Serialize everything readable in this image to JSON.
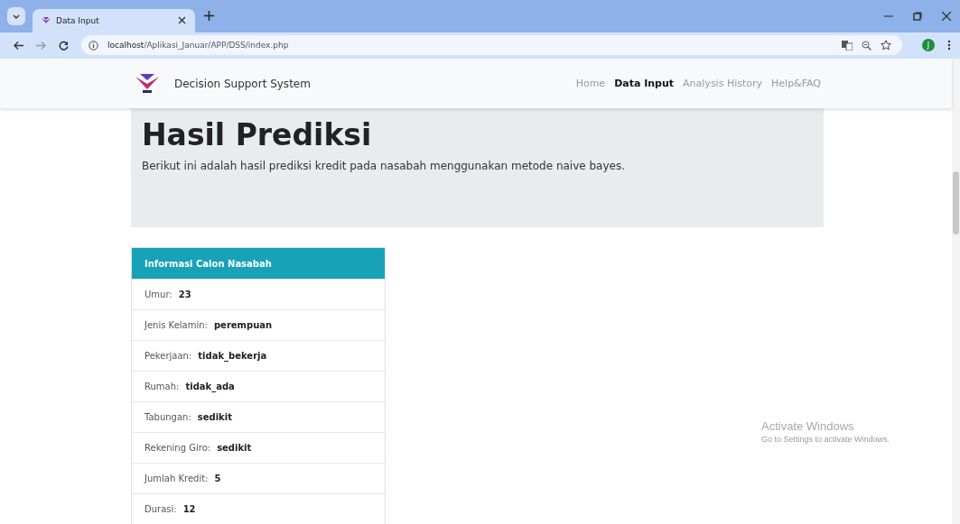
{
  "browser": {
    "tab_title": "Data Input",
    "url_host": "localhost",
    "url_path": "/Aplikasi_Januar/APP/DSS/index.php",
    "profile_initial": "J"
  },
  "navbar": {
    "brand": "Decision Support System",
    "links": [
      {
        "label": "Home",
        "selected": false
      },
      {
        "label": "Data Input",
        "selected": true
      },
      {
        "label": "Analysis History",
        "selected": false
      },
      {
        "label": "Help&FAQ",
        "selected": false
      }
    ]
  },
  "hero": {
    "title": "Hasil Prediksi",
    "description": "Berikut ini adalah hasil prediksi kredit pada nasabah menggunakan metode naive bayes."
  },
  "card": {
    "header": "Informasi Calon Nasabah",
    "rows": [
      {
        "label": "Umur:",
        "value": "23"
      },
      {
        "label": "Jenis Kelamin:",
        "value": "perempuan"
      },
      {
        "label": "Pekerjaan:",
        "value": "tidak_bekerja"
      },
      {
        "label": "Rumah:",
        "value": "tidak_ada"
      },
      {
        "label": "Tabungan:",
        "value": "sedikit"
      },
      {
        "label": "Rekening Giro:",
        "value": "sedikit"
      },
      {
        "label": "Jumlah Kredit:",
        "value": "5"
      },
      {
        "label": "Durasi:",
        "value": "12"
      }
    ]
  },
  "activation": {
    "title": "Activate Windows",
    "subtitle": "Go to Settings to activate Windows."
  }
}
